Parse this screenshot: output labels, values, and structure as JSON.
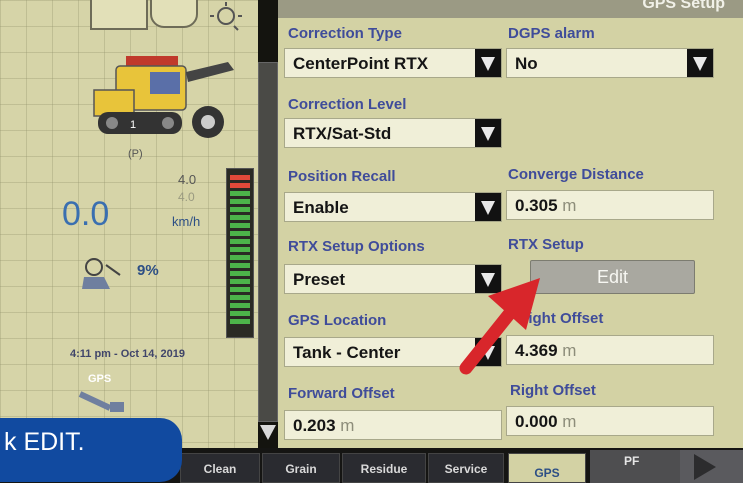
{
  "left_panel": {
    "park_indicator": "(P)",
    "speed_value": "0.0",
    "speed_set_top": "4.0",
    "speed_set_mid": "4.0",
    "speed_unit": "km/h",
    "fuel_percent": "9%",
    "datetime": "4:11 pm - Oct 14, 2019",
    "gps_label": "GPS"
  },
  "gps_setup": {
    "title": "GPS Setup",
    "correction_type": {
      "label": "Correction Type",
      "value": "CenterPoint RTX"
    },
    "dgps_alarm": {
      "label": "DGPS alarm",
      "value": "No"
    },
    "correction_level": {
      "label": "Correction Level",
      "value": "RTX/Sat-Std"
    },
    "position_recall": {
      "label": "Position Recall",
      "value": "Enable"
    },
    "converge_distance": {
      "label": "Converge Distance",
      "value": "0.305",
      "unit": "m"
    },
    "rtx_setup_options": {
      "label": "RTX Setup Options",
      "value": "Preset"
    },
    "rtx_setup": {
      "label": "RTX Setup",
      "button": "Edit"
    },
    "gps_location": {
      "label": "GPS Location",
      "value": "Tank - Center"
    },
    "height_offset": {
      "label": "eight Offset",
      "value": "4.369",
      "unit": "m"
    },
    "forward_offset": {
      "label": "Forward Offset",
      "value": "0.203",
      "unit": "m"
    },
    "right_offset": {
      "label": "Right Offset",
      "value": "0.000",
      "unit": "m"
    }
  },
  "bottom_tabs": [
    "Clean",
    "Grain",
    "Residue",
    "Service",
    "GPS"
  ],
  "pf_tab": "PF",
  "caption": "k EDIT.",
  "colors": {
    "label_blue": "#3f4c9a",
    "panel_bg": "#d3d2a4",
    "caption_blue": "#114aa0",
    "arrow_red": "#d8262b"
  }
}
